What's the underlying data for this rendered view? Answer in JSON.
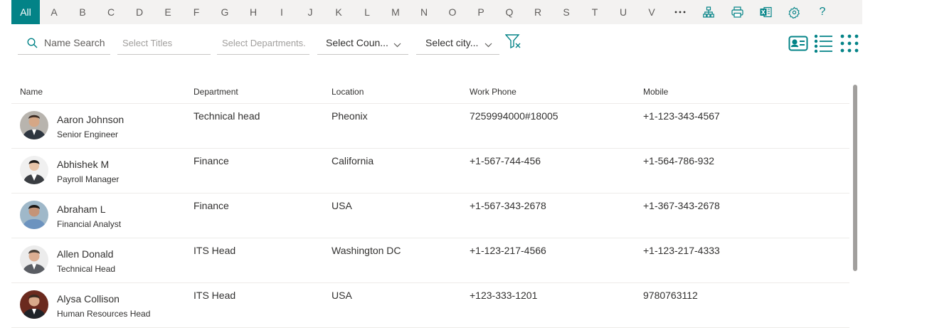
{
  "alphabet": {
    "all_label": "All",
    "letters": [
      "A",
      "B",
      "C",
      "D",
      "E",
      "F",
      "G",
      "H",
      "I",
      "J",
      "K",
      "L",
      "M",
      "N",
      "O",
      "P",
      "Q",
      "R",
      "S",
      "T",
      "U",
      "V"
    ],
    "icons": [
      "more-icon",
      "org-chart-icon",
      "print-icon",
      "excel-icon",
      "settings-icon",
      "help-icon"
    ],
    "help_label": "?"
  },
  "filters": {
    "name_search": "Name Search",
    "titles_placeholder": "Select Titles",
    "departments_placeholder": "Select Departments.",
    "country_label": "Select Coun...",
    "city_label": "Select city..."
  },
  "view_icons": [
    "contact-card-icon",
    "list-view-icon",
    "grid-view-icon"
  ],
  "table": {
    "headers": {
      "name": "Name",
      "department": "Department",
      "location": "Location",
      "work_phone": "Work Phone",
      "mobile": "Mobile"
    },
    "rows": [
      {
        "name": "Aaron Johnson",
        "title": "Senior Engineer",
        "department": "Technical head",
        "location": "Pheonix",
        "work_phone": "7259994000#18005",
        "mobile": "+1-123-343-4567"
      },
      {
        "name": "Abhishek M",
        "title": "Payroll Manager",
        "department": "Finance",
        "location": "California",
        "work_phone": "+1-567-744-456",
        "mobile": "+1-564-786-932"
      },
      {
        "name": "Abraham L",
        "title": "Financial Analyst",
        "department": "Finance",
        "location": "USA",
        "work_phone": "+1-567-343-2678",
        "mobile": "+1-367-343-2678"
      },
      {
        "name": "Allen Donald",
        "title": "Technical Head",
        "department": "ITS Head",
        "location": "Washington DC",
        "work_phone": "+1-123-217-4566",
        "mobile": "+1-123-217-4333"
      },
      {
        "name": "Alysa Collison",
        "title": "Human Resources Head",
        "department": "ITS Head",
        "location": "USA",
        "work_phone": "+123-333-1201",
        "mobile": "9780763112"
      }
    ]
  },
  "colors": {
    "accent": "#038387",
    "bar_bg": "#f3f2f1"
  }
}
